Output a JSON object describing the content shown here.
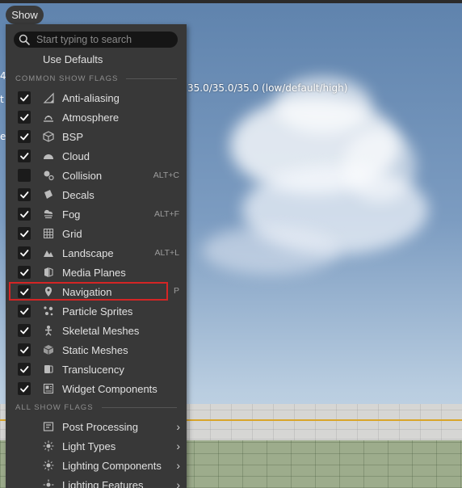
{
  "toolbar": {
    "show_label": "Show"
  },
  "viewport": {
    "stat_text": "35.0/35.0/35.0 (low/default/high)",
    "edge_chars": [
      "4",
      "t",
      "e"
    ]
  },
  "menu": {
    "search_placeholder": "Start typing to search",
    "use_defaults": "Use Defaults",
    "common_section": "COMMON SHOW FLAGS",
    "all_section": "ALL SHOW FLAGS",
    "common_flags": [
      {
        "label": "Anti-aliasing",
        "checked": true,
        "shortcut": "",
        "icon": "anti-aliasing-icon"
      },
      {
        "label": "Atmosphere",
        "checked": true,
        "shortcut": "",
        "icon": "atmosphere-icon"
      },
      {
        "label": "BSP",
        "checked": true,
        "shortcut": "",
        "icon": "bsp-icon"
      },
      {
        "label": "Cloud",
        "checked": true,
        "shortcut": "",
        "icon": "cloud-icon"
      },
      {
        "label": "Collision",
        "checked": false,
        "shortcut": "ALT+C",
        "icon": "collision-icon"
      },
      {
        "label": "Decals",
        "checked": true,
        "shortcut": "",
        "icon": "decals-icon"
      },
      {
        "label": "Fog",
        "checked": true,
        "shortcut": "ALT+F",
        "icon": "fog-icon"
      },
      {
        "label": "Grid",
        "checked": true,
        "shortcut": "",
        "icon": "grid-icon"
      },
      {
        "label": "Landscape",
        "checked": true,
        "shortcut": "ALT+L",
        "icon": "landscape-icon"
      },
      {
        "label": "Media Planes",
        "checked": true,
        "shortcut": "",
        "icon": "media-planes-icon"
      },
      {
        "label": "Navigation",
        "checked": true,
        "shortcut": "P",
        "icon": "navigation-pin-icon"
      },
      {
        "label": "Particle Sprites",
        "checked": true,
        "shortcut": "",
        "icon": "particle-sprites-icon"
      },
      {
        "label": "Skeletal Meshes",
        "checked": true,
        "shortcut": "",
        "icon": "skeletal-meshes-icon"
      },
      {
        "label": "Static Meshes",
        "checked": true,
        "shortcut": "",
        "icon": "static-meshes-icon"
      },
      {
        "label": "Translucency",
        "checked": true,
        "shortcut": "",
        "icon": "translucency-icon"
      },
      {
        "label": "Widget Components",
        "checked": true,
        "shortcut": "",
        "icon": "widget-components-icon"
      }
    ],
    "all_flags": [
      {
        "label": "Post Processing",
        "icon": "post-processing-icon"
      },
      {
        "label": "Light Types",
        "icon": "light-types-icon"
      },
      {
        "label": "Lighting Components",
        "icon": "lighting-components-icon"
      },
      {
        "label": "Lighting Features",
        "icon": "lighting-features-icon"
      }
    ],
    "submenu_arrow": "›"
  },
  "colors": {
    "highlight": "#d42525",
    "menu_bg": "#383838",
    "check": "#ffffff"
  }
}
